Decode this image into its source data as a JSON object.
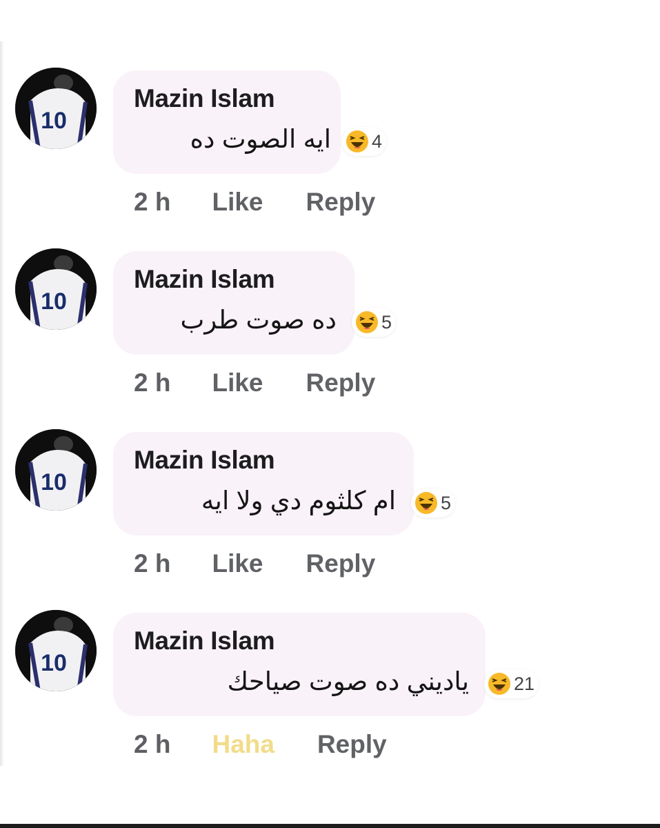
{
  "colors": {
    "bubble_background": "#f9f2f8",
    "author_text": "#1d1d1f",
    "meta_text": "#606266",
    "haha_reaction": "#f7b928",
    "active_haha_label": "#f2dc8a"
  },
  "comments": [
    {
      "author": "Mazin Islam",
      "avatar_jersey_number": "10",
      "text": "ايه الصوت ده",
      "reaction_icon": "haha-icon",
      "reaction_count": "4",
      "time": "2 h",
      "like_label": "Like",
      "reply_label": "Reply"
    },
    {
      "author": "Mazin Islam",
      "avatar_jersey_number": "10",
      "text": "ده صوت طرب",
      "reaction_icon": "haha-icon",
      "reaction_count": "5",
      "time": "2 h",
      "like_label": "Like",
      "reply_label": "Reply"
    },
    {
      "author": "Mazin Islam",
      "avatar_jersey_number": "10",
      "text": "ام كلثوم دي ولا ايه",
      "reaction_icon": "haha-icon",
      "reaction_count": "5",
      "time": "2 h",
      "like_label": "Like",
      "reply_label": "Reply"
    },
    {
      "author": "Mazin Islam",
      "avatar_jersey_number": "10",
      "text": "ياديني ده صوت صياحك",
      "reaction_icon": "haha-icon",
      "reaction_count": "21",
      "time": "2 h",
      "like_label": "Haha",
      "reply_label": "Reply"
    }
  ]
}
